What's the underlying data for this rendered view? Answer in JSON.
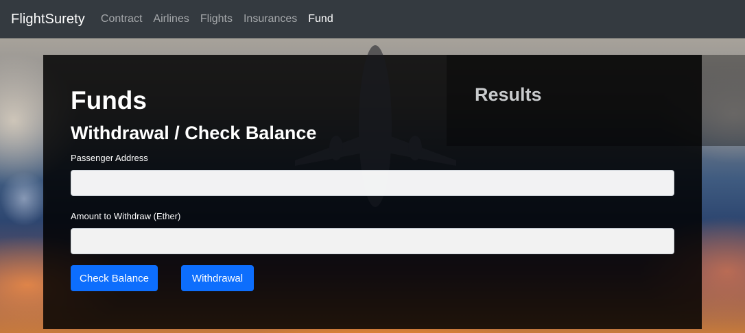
{
  "navbar": {
    "brand": "FlightSurety",
    "links": [
      {
        "label": "Contract"
      },
      {
        "label": "Airlines"
      },
      {
        "label": "Flights"
      },
      {
        "label": "Insurances"
      },
      {
        "label": "Fund",
        "active": true
      }
    ]
  },
  "funds": {
    "title": "Funds",
    "subtitle": "Withdrawal / Check Balance",
    "passenger_address_label": "Passenger Address",
    "passenger_address_value": "",
    "amount_label": "Amount to Withdraw (Ether)",
    "amount_value": "",
    "check_balance_label": "Check Balance",
    "withdrawal_label": "Withdrawal"
  },
  "results": {
    "title": "Results"
  },
  "colors": {
    "navbar_bg": "#343a40",
    "primary_button": "#0d6efd",
    "panel_bg": "rgba(0,0,0,0.84)"
  }
}
